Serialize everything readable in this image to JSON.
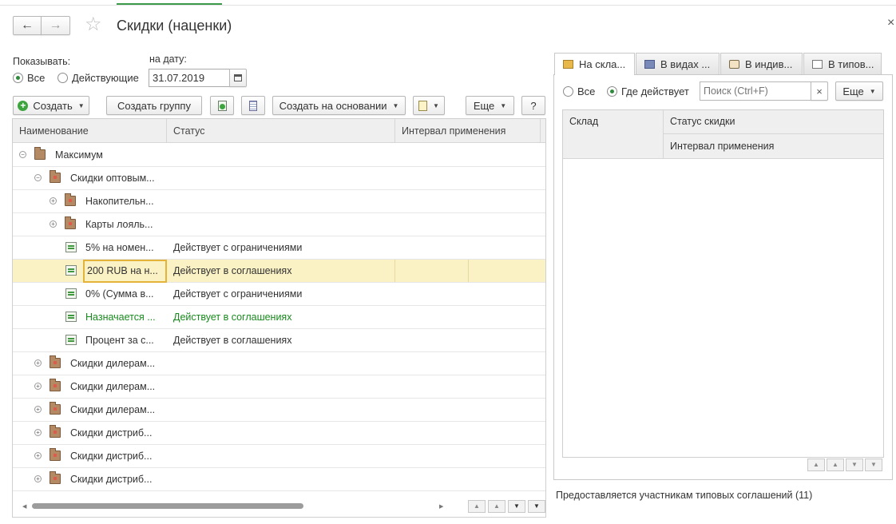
{
  "window": {
    "title": "Скидки (наценки)",
    "close_glyph": "×"
  },
  "nav": {
    "back_glyph": "🡐",
    "forward_glyph": "🡒",
    "star_glyph": "☆"
  },
  "filter": {
    "show_label": "Показывать:",
    "date_label": "на дату:",
    "radio_all": "Все",
    "radio_active": "Действующие",
    "selected": "Все",
    "date_value": "31.07.2019"
  },
  "toolbar": {
    "create": "Создать",
    "create_group": "Создать группу",
    "create_based_on": "Создать на основании",
    "more": "Еще",
    "help": "?"
  },
  "grid": {
    "columns": [
      "Наименование",
      "Статус",
      "Интервал применения"
    ],
    "rows": [
      {
        "name": "Максимум",
        "status": "",
        "level": 0,
        "toggle": "⊖",
        "icon": "folder-icon"
      },
      {
        "name": "Скидки оптовым...",
        "status": "",
        "level": 1,
        "toggle": "⊖",
        "icon": "folder-icon"
      },
      {
        "name": "Накопительн...",
        "status": "",
        "level": 2,
        "toggle": "⊕",
        "icon": "folder-icon"
      },
      {
        "name": "Карты лояль...",
        "status": "",
        "level": 2,
        "toggle": "⊕",
        "icon": "card-folder-icon"
      },
      {
        "name": "5% на номен...",
        "status": "Действует с ограничениями",
        "level": 2,
        "toggle": "",
        "icon": "discount-icon"
      },
      {
        "name": "200 RUB на н...",
        "status": "Действует в соглашениях",
        "level": 2,
        "toggle": "",
        "icon": "discount-icon",
        "selected": true
      },
      {
        "name": "0% (Сумма в...",
        "status": "Действует с ограничениями",
        "level": 2,
        "toggle": "",
        "icon": "discount-icon"
      },
      {
        "name": "Назначается ...",
        "status": "Действует в соглашениях",
        "level": 2,
        "toggle": "",
        "icon": "manual-discount-icon",
        "green": true
      },
      {
        "name": "Процент за с...",
        "status": "Действует в соглашениях",
        "level": 2,
        "toggle": "",
        "icon": "discount-icon"
      },
      {
        "name": "Скидки дилерам...",
        "status": "",
        "level": 1,
        "toggle": "⊕",
        "icon": "folder-icon"
      },
      {
        "name": "Скидки дилерам...",
        "status": "",
        "level": 1,
        "toggle": "⊕",
        "icon": "folder-icon"
      },
      {
        "name": "Скидки дилерам...",
        "status": "",
        "level": 1,
        "toggle": "⊕",
        "icon": "folder-icon"
      },
      {
        "name": "Скидки дистриб...",
        "status": "",
        "level": 1,
        "toggle": "⊕",
        "icon": "folder-icon"
      },
      {
        "name": "Скидки дистриб...",
        "status": "",
        "level": 1,
        "toggle": "⊕",
        "icon": "folder-icon"
      },
      {
        "name": "Скидки дистриб...",
        "status": "",
        "level": 1,
        "toggle": "⊕",
        "icon": "folder-icon"
      }
    ]
  },
  "right_panel": {
    "tabs": [
      "На скла...",
      "В видах ...",
      "В индив...",
      "В типов..."
    ],
    "active_tab": 0,
    "radio_all": "Все",
    "radio_where": "Где действует",
    "selected": "Где действует",
    "search_placeholder": "Поиск (Ctrl+F)",
    "search_clear": "×",
    "more": "Еще",
    "columns": {
      "warehouse": "Склад",
      "status": "Статус скидки",
      "interval": "Интервал применения"
    },
    "footer": "Предоставляется участникам типовых соглашений (11)"
  },
  "colors": {
    "accent_green": "#2f8a3b",
    "selection": "#faf1c4",
    "green_text": "#188a1d"
  }
}
